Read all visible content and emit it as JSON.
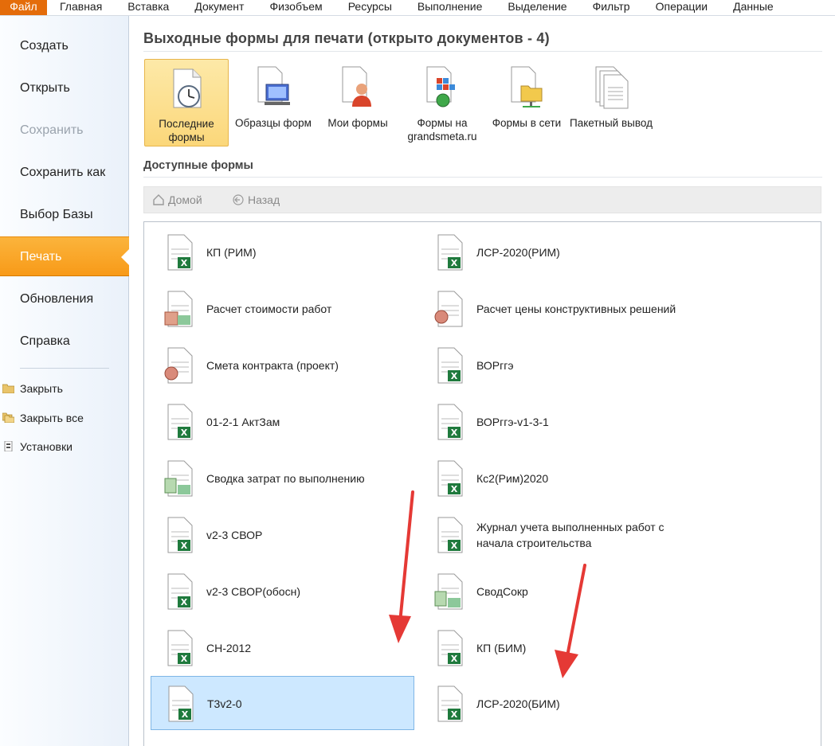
{
  "menubar": {
    "items": [
      "Файл",
      "Главная",
      "Вставка",
      "Документ",
      "Физобъем",
      "Ресурсы",
      "Выполнение",
      "Выделение",
      "Фильтр",
      "Операции",
      "Данные"
    ]
  },
  "sidebar": {
    "items": [
      "Создать",
      "Открыть",
      "Сохранить",
      "Сохранить как",
      "Выбор Базы",
      "Печать",
      "Обновления",
      "Справка"
    ],
    "small_items": [
      "Закрыть",
      "Закрыть все",
      "Установки"
    ]
  },
  "main": {
    "title": "Выходные формы для печати (открыто документов - 4)",
    "tools": [
      {
        "label": "Последние формы",
        "icon": "recent-forms-icon"
      },
      {
        "label": "Образцы форм",
        "icon": "form-samples-icon"
      },
      {
        "label": "Мои формы",
        "icon": "my-forms-icon"
      },
      {
        "label": "Формы на grandsmeta.ru",
        "icon": "web-forms-icon"
      },
      {
        "label": "Формы в сети",
        "icon": "network-forms-icon"
      },
      {
        "label": "Пакетный вывод",
        "icon": "batch-output-icon"
      }
    ],
    "available_title": "Доступные формы",
    "nav": {
      "home": "Домой",
      "back": "Назад"
    },
    "forms": [
      "КП (РИМ)",
      "ЛСР-2020(РИМ)",
      "Расчет стоимости работ",
      "Расчет цены конструктивных решений",
      "Смета контракта (проект)",
      "ВОРггэ",
      "01-2-1 АктЗам",
      "ВОРггэ-v1-3-1",
      "Сводка затрат по выполнению",
      "Кс2(Рим)2020",
      "v2-3 СВОР",
      "Журнал учета выполненных работ с начала строительства",
      "v2-3 СВОР(обосн)",
      "СводСокр",
      "СН-2012",
      "КП (БИМ)",
      "Т3v2-0",
      "ЛСР-2020(БИМ)"
    ],
    "selected_form": "Т3v2-0"
  },
  "colors": {
    "accent": "#f89a18",
    "file_tab": "#e46c0a",
    "selection": "#cde8ff",
    "annotation_arrow": "#e53935"
  }
}
